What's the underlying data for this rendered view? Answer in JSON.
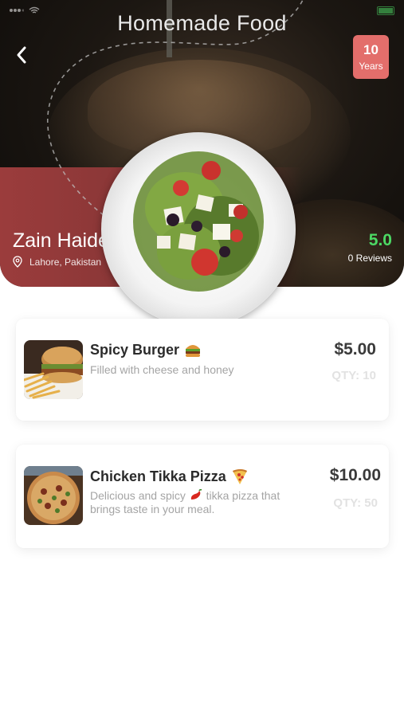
{
  "header": {
    "title": "Homemade Food",
    "years_badge": {
      "number": "10",
      "label": "Years"
    }
  },
  "chef": {
    "name": "Zain Haider",
    "location": "Lahore, Pakistan",
    "rating": "5.0",
    "reviews": "0 Reviews"
  },
  "menu": {
    "items": [
      {
        "title": "Spicy Burger",
        "emoji": "burger-icon",
        "description": "Filled with cheese and honey",
        "price": "$5.00",
        "qty": "QTY: 10"
      },
      {
        "title": "Chicken Tikka Pizza",
        "emoji": "pizza-icon",
        "description_before": "Delicious and spicy",
        "description_emoji": "chili-pepper-icon",
        "description_after": "tikka pizza that brings taste in your meal.",
        "price": "$10.00",
        "qty": "QTY: 50"
      }
    ]
  },
  "colors": {
    "accent_red": "#e36e6b",
    "hero_band": "#9b3c3c",
    "rating_green": "#4cd964",
    "price_text": "#3a3a3a",
    "muted_text": "#a4a4a4"
  }
}
